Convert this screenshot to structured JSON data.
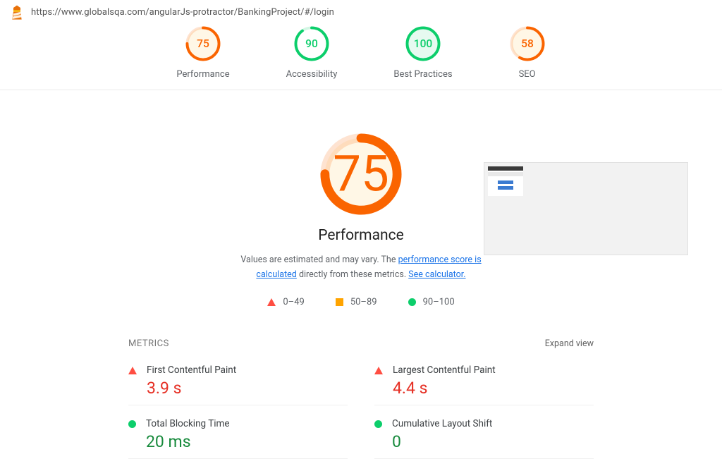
{
  "url": "https://www.globalsqa.com/angularJs-protractor/BankingProject/#/login",
  "gauges": [
    {
      "label": "Performance",
      "score": "75",
      "color": "#fa6400",
      "fill": "#fff7e6",
      "pct": 75
    },
    {
      "label": "Accessibility",
      "score": "90",
      "color": "#0cce6b",
      "fill": "#ffffff",
      "pct": 90
    },
    {
      "label": "Best Practices",
      "score": "100",
      "color": "#0cce6b",
      "fill": "#e6faf0",
      "pct": 100
    },
    {
      "label": "SEO",
      "score": "58",
      "color": "#fa6400",
      "fill": "#fff7e6",
      "pct": 58
    }
  ],
  "big_gauge": {
    "score": "75",
    "color": "#fa6400",
    "fill": "#fff7e6",
    "pct": 75
  },
  "perf_title": "Performance",
  "perf_desc_pre": "Values are estimated and may vary. The ",
  "perf_desc_link1": "performance score is calculated",
  "perf_desc_mid": " directly from these metrics. ",
  "perf_desc_link2": "See calculator.",
  "legend": {
    "r0": "0–49",
    "r1": "50–89",
    "r2": "90–100"
  },
  "metrics_heading": "METRICS",
  "expand_label": "Expand view",
  "metrics": [
    {
      "name": "First Contentful Paint",
      "value": "3.9 s",
      "status": "fail"
    },
    {
      "name": "Largest Contentful Paint",
      "value": "4.4 s",
      "status": "fail"
    },
    {
      "name": "Total Blocking Time",
      "value": "20 ms",
      "status": "pass"
    },
    {
      "name": "Cumulative Layout Shift",
      "value": "0",
      "status": "pass"
    }
  ]
}
